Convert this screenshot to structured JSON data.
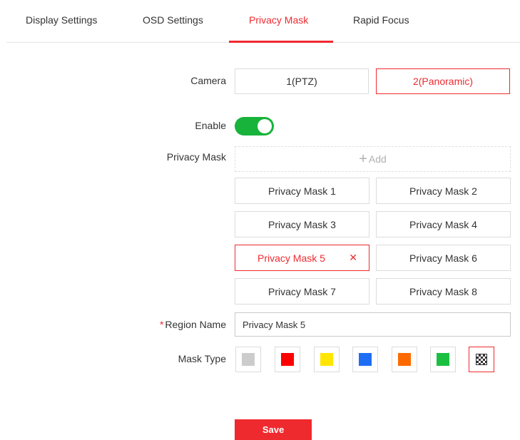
{
  "tabs": [
    {
      "label": "Display Settings",
      "active": false
    },
    {
      "label": "OSD Settings",
      "active": false
    },
    {
      "label": "Privacy Mask",
      "active": true
    },
    {
      "label": "Rapid Focus",
      "active": false
    }
  ],
  "form": {
    "camera_label": "Camera",
    "camera_options": [
      {
        "label": "1(PTZ)",
        "selected": false
      },
      {
        "label": "2(Panoramic)",
        "selected": true
      }
    ],
    "enable_label": "Enable",
    "enable_on": true,
    "privacy_mask_label": "Privacy Mask",
    "add_label": "Add",
    "add_icon": "plus-icon",
    "masks": [
      {
        "label": "Privacy Mask 1",
        "selected": false
      },
      {
        "label": "Privacy Mask 2",
        "selected": false
      },
      {
        "label": "Privacy Mask 3",
        "selected": false
      },
      {
        "label": "Privacy Mask 4",
        "selected": false
      },
      {
        "label": "Privacy Mask 5",
        "selected": true
      },
      {
        "label": "Privacy Mask 6",
        "selected": false
      },
      {
        "label": "Privacy Mask 7",
        "selected": false
      },
      {
        "label": "Privacy Mask 8",
        "selected": false
      }
    ],
    "delete_icon": "close-icon",
    "region_required_mark": "*",
    "region_label": "Region Name",
    "region_value": "Privacy Mask 5",
    "mask_type_label": "Mask Type",
    "mask_types": [
      {
        "name": "gray",
        "color": "#cccccc",
        "selected": false
      },
      {
        "name": "red",
        "color": "#ff0000",
        "selected": false
      },
      {
        "name": "yellow",
        "color": "#ffe600",
        "selected": false
      },
      {
        "name": "blue",
        "color": "#1e6ef5",
        "selected": false
      },
      {
        "name": "orange",
        "color": "#ff6a00",
        "selected": false
      },
      {
        "name": "green",
        "color": "#19c040",
        "selected": false
      },
      {
        "name": "mosaic",
        "icon": "mosaic-icon",
        "selected": true
      }
    ]
  },
  "actions": {
    "save_label": "Save"
  },
  "colors": {
    "accent": "#ef2a2f",
    "toggle_on": "#17b33b"
  }
}
